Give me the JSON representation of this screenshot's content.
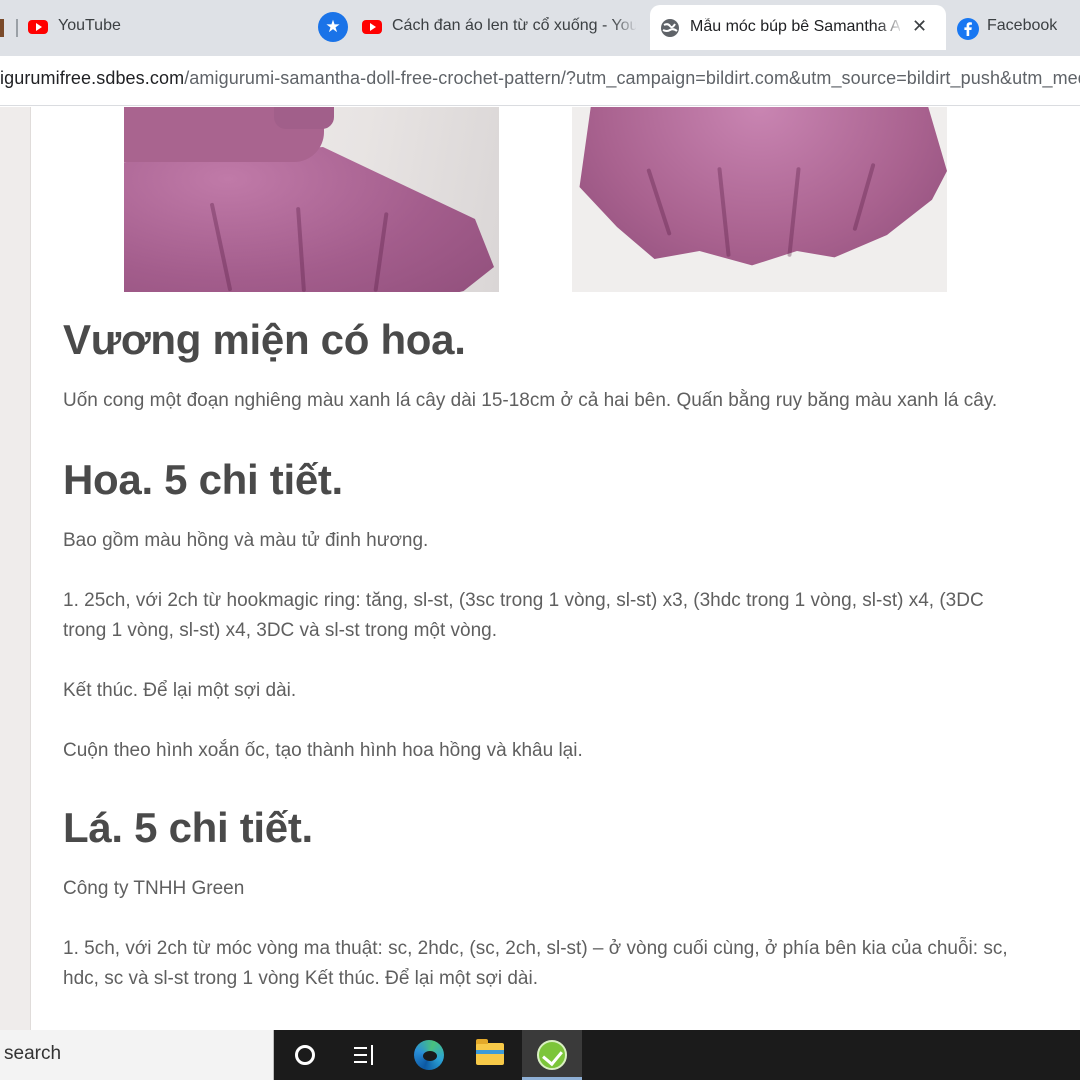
{
  "browser": {
    "tabs": [
      {
        "title": "YouTube",
        "icon": "youtube-icon",
        "active": false
      },
      {
        "title": "Cách đan áo len từ cổ xuống - You",
        "icon": "youtube-icon",
        "active": false
      },
      {
        "title": "Mẫu móc búp bê Samantha A",
        "icon": "globe-icon",
        "active": true
      },
      {
        "title": "Facebook",
        "icon": "facebook-icon",
        "active": false
      }
    ],
    "close_glyph": "✕",
    "bookmark_glyph": "★",
    "url_host": "igurumifree.sdbes.com",
    "url_rest": "/amigurumi-samantha-doll-free-crochet-pattern/?utm_campaign=bildirt.com&utm_source=bildirt_push&utm_mediun"
  },
  "article": {
    "sections": [
      {
        "heading": "Vương miện có hoa.",
        "paragraphs": [
          "Uốn cong một đoạn nghiêng màu xanh lá cây dài 15-18cm ở cả hai bên. Quấn bằng ruy băng màu xanh lá cây."
        ]
      },
      {
        "heading": "Hoa. 5 chi tiết.",
        "paragraphs": [
          "Bao gồm màu hồng và màu tử đinh hương.",
          "1. 25ch, với 2ch từ hookmagic ring: tăng, sl-st, (3sc trong 1 vòng, sl-st) x3, (3hdc trong 1 vòng, sl-st) x4, (3DC trong 1 vòng, sl-st) x4, 3DC và sl-st trong một vòng.",
          "Kết thúc. Để lại một sợi dài.",
          "Cuộn theo hình xoắn ốc, tạo thành hình hoa hồng và khâu lại."
        ]
      },
      {
        "heading": "Lá. 5 chi tiết.",
        "paragraphs": [
          "Công ty TNHH Green",
          "1. 5ch, với 2ch từ móc vòng ma thuật: sc, 2hdc, (sc, 2ch, sl-st) – ở vòng cuối cùng, ở phía bên kia của chuỗi: sc, hdc, sc và sl-st trong 1 vòng Kết thúc. Để lại một sợi dài."
        ]
      }
    ]
  },
  "taskbar": {
    "search_text": "search",
    "apps": [
      "cortana-icon",
      "task-view-icon",
      "edge-icon",
      "file-explorer-icon",
      "green-app-icon"
    ]
  },
  "colors": {
    "youtube": "#ff0000",
    "facebook": "#1877f2",
    "bookmark": "#1a73e8",
    "heading": "#4a4a4a",
    "body_text": "#5f5f5f",
    "crochet_pink": "#a9648f"
  }
}
